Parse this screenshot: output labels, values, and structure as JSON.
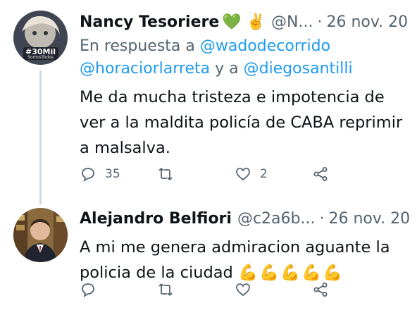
{
  "tweets": [
    {
      "author_name": "Nancy Tesoriere",
      "author_emojis": "💚 ✌️",
      "handle": "@N...",
      "dot": "·",
      "date": "26 nov. 20",
      "reply_prefix": "En respuesta a",
      "reply_mentions": [
        "@wadodecorrido",
        "@horaciorlarreta",
        "@diegosantilli"
      ],
      "reply_joiner": "y a",
      "text": "Me da mucha tristeza e impotencia de ver a la maldita policía de CABA reprimir a malsalva.",
      "avatar_badge": "#30Mil",
      "avatar_badge_sub": "SomosTodos",
      "actions": {
        "reply_count": "35",
        "retweet_count": "",
        "like_count": "2"
      }
    },
    {
      "author_name": "Alejandro Belfiori",
      "handle": "@c2a6b...",
      "dot": "·",
      "date": "26 nov. 20",
      "text": "A mi me genera admiracion aguante la policia de la ciudad",
      "text_emojis": "💪💪💪💪💪",
      "actions": {
        "reply_count": "",
        "retweet_count": "",
        "like_count": ""
      }
    }
  ],
  "colors": {
    "accent": "#1d9bf0",
    "muted": "#536471",
    "line": "#cfd9de"
  }
}
